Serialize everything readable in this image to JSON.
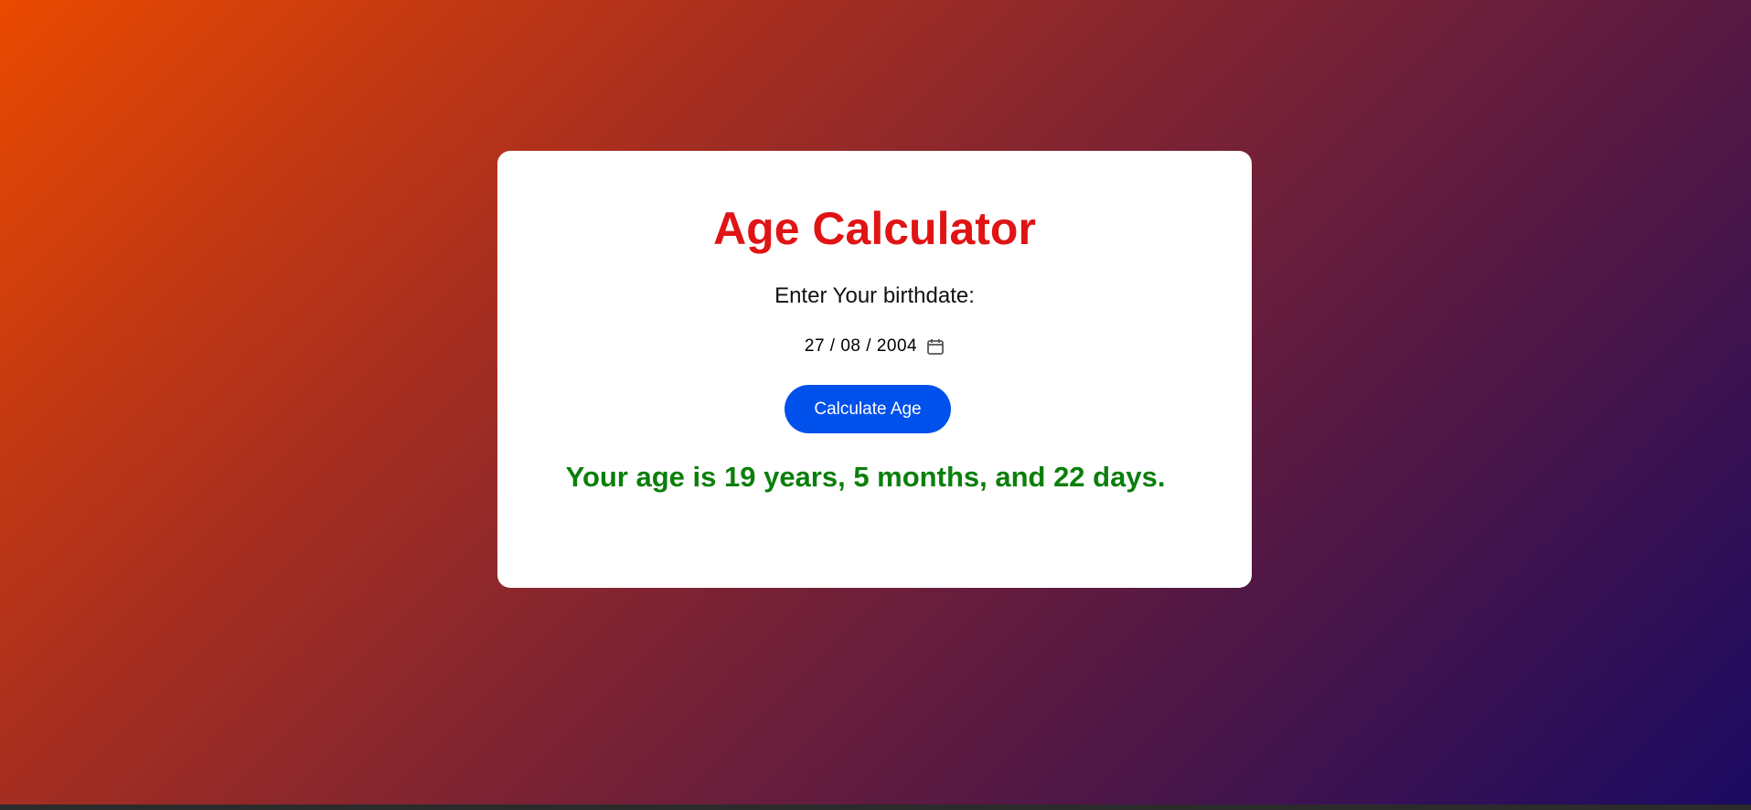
{
  "app": {
    "title": "Age Calculator"
  },
  "form": {
    "label": "Enter Your birthdate:",
    "birthdate_display": "27 / 08 / 2004",
    "calculate_button_label": "Calculate Age"
  },
  "result": {
    "text": "Your age is 19 years, 5 months, and 22 days."
  },
  "colors": {
    "title": "#e01414",
    "button": "#0051ec",
    "result": "#0b7f0b",
    "gradient_start": "#ea4a00",
    "gradient_end": "#1a0a62"
  },
  "icons": {
    "date_picker": "calendar-icon"
  }
}
